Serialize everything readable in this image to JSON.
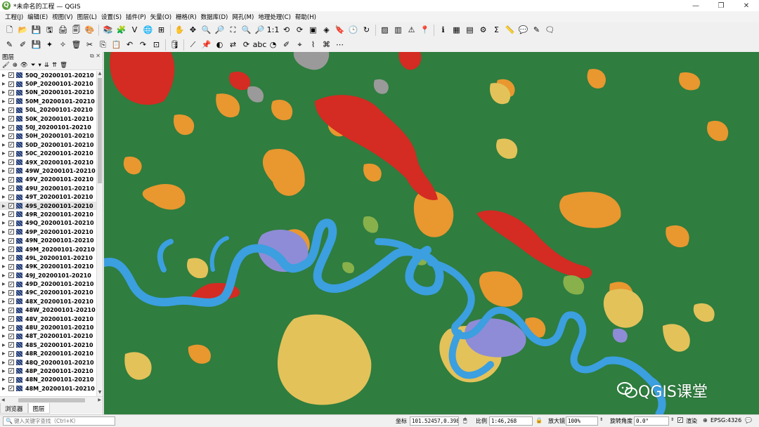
{
  "window": {
    "title": "*未命名的工程 — QGIS",
    "app_icon": "Q",
    "controls": {
      "minimize": "—",
      "maximize": "❐",
      "close": "✕"
    }
  },
  "menu": [
    "工程(J)",
    "编辑(E)",
    "视图(V)",
    "图层(L)",
    "设置(S)",
    "插件(P)",
    "矢量(O)",
    "栅格(R)",
    "数据库(D)",
    "网孔(M)",
    "地理处理(C)",
    "帮助(H)"
  ],
  "toolbar1": [
    {
      "icon": "new-project-icon",
      "glyph": "🗋"
    },
    {
      "icon": "open-project-icon",
      "glyph": "📂"
    },
    {
      "icon": "save-project-icon",
      "glyph": "💾"
    },
    {
      "icon": "save-as-icon",
      "glyph": "🖫"
    },
    {
      "icon": "new-print-layout-icon",
      "glyph": "🖨"
    },
    {
      "icon": "layout-manager-icon",
      "glyph": "🗐"
    },
    {
      "icon": "style-manager-icon",
      "glyph": "🎨"
    },
    {
      "sep": true
    },
    {
      "icon": "data-source-manager-icon",
      "glyph": "📚"
    },
    {
      "icon": "add-raster-icon",
      "glyph": "🧩"
    },
    {
      "icon": "add-vector-icon",
      "glyph": "V"
    },
    {
      "icon": "add-wms-icon",
      "glyph": "🌐"
    },
    {
      "icon": "add-mesh-icon",
      "glyph": "⊞"
    },
    {
      "sep": true
    },
    {
      "icon": "pan-icon",
      "glyph": "✋"
    },
    {
      "icon": "pan-to-selection-icon",
      "glyph": "✥"
    },
    {
      "icon": "zoom-in-icon",
      "glyph": "🔍"
    },
    {
      "icon": "zoom-out-icon",
      "glyph": "🔎"
    },
    {
      "icon": "zoom-full-icon",
      "glyph": "⛶"
    },
    {
      "icon": "zoom-layer-icon",
      "glyph": "🔍"
    },
    {
      "icon": "zoom-selection-icon",
      "glyph": "🔎"
    },
    {
      "icon": "zoom-native-icon",
      "glyph": "1:1"
    },
    {
      "icon": "zoom-last-icon",
      "glyph": "⟲"
    },
    {
      "icon": "zoom-next-icon",
      "glyph": "⟳"
    },
    {
      "icon": "new-map-view-icon",
      "glyph": "▣"
    },
    {
      "icon": "new-3d-view-icon",
      "glyph": "◈"
    },
    {
      "icon": "bookmark-icon",
      "glyph": "🔖"
    },
    {
      "icon": "temporal-controller-icon",
      "glyph": "🕒"
    },
    {
      "icon": "refresh-icon",
      "glyph": "↻"
    },
    {
      "sep": true
    },
    {
      "icon": "select-features-icon",
      "glyph": "▨"
    },
    {
      "icon": "select-value-icon",
      "glyph": "▥"
    },
    {
      "icon": "deselect-icon",
      "glyph": "⚠"
    },
    {
      "icon": "select-location-icon",
      "glyph": "📍"
    },
    {
      "sep": true
    },
    {
      "icon": "identify-icon",
      "glyph": "ℹ"
    },
    {
      "icon": "attribute-table-icon",
      "glyph": "▦"
    },
    {
      "icon": "field-calc-icon",
      "glyph": "▤"
    },
    {
      "icon": "processing-toolbox-icon",
      "glyph": "⚙"
    },
    {
      "icon": "statistical-summary-icon",
      "glyph": "Σ"
    },
    {
      "icon": "measure-icon",
      "glyph": "📏"
    },
    {
      "icon": "map-tips-icon",
      "glyph": "💬"
    },
    {
      "icon": "annotation-icon",
      "glyph": "✎"
    },
    {
      "icon": "text-annotation-icon",
      "glyph": "🗨"
    }
  ],
  "toolbar2": [
    {
      "icon": "edit-pencil-icon",
      "glyph": "✎"
    },
    {
      "icon": "toggle-edit-icon",
      "glyph": "✐"
    },
    {
      "icon": "save-edits-icon",
      "glyph": "💾"
    },
    {
      "icon": "add-feature-icon",
      "glyph": "✦"
    },
    {
      "icon": "vertex-tool-icon",
      "glyph": "✧"
    },
    {
      "icon": "delete-selected-icon",
      "glyph": "🗑"
    },
    {
      "icon": "cut-features-icon",
      "glyph": "✂"
    },
    {
      "icon": "copy-features-icon",
      "glyph": "⎘"
    },
    {
      "icon": "paste-features-icon",
      "glyph": "📋"
    },
    {
      "icon": "undo-icon",
      "glyph": "↶"
    },
    {
      "icon": "redo-icon",
      "glyph": "↷"
    },
    {
      "icon": "digitize-options-icon",
      "glyph": "⊡"
    },
    {
      "sep": true
    },
    {
      "icon": "database-icon",
      "glyph": "🛢"
    },
    {
      "sep": true
    },
    {
      "icon": "label-tool-icon",
      "glyph": "⟋"
    },
    {
      "icon": "label-pin-icon",
      "glyph": "📌"
    },
    {
      "icon": "label-show-icon",
      "glyph": "◐"
    },
    {
      "icon": "label-move-icon",
      "glyph": "⇄"
    },
    {
      "icon": "label-rotate-icon",
      "glyph": "⟳"
    },
    {
      "icon": "label-change-icon",
      "glyph": "abc"
    },
    {
      "icon": "diagram-icon",
      "glyph": "◔"
    },
    {
      "icon": "label-highlight-icon",
      "glyph": "✐"
    },
    {
      "icon": "label-unpin-icon",
      "glyph": "⌖"
    },
    {
      "icon": "label-callout-icon",
      "glyph": "⌇"
    },
    {
      "icon": "label-toggle-icon",
      "glyph": "⌘"
    },
    {
      "icon": "label-more-icon",
      "glyph": "⋯"
    }
  ],
  "layers_panel": {
    "title": "图层",
    "layers": [
      "50Q_20200101-20210",
      "50P_20200101-20210",
      "50N_20200101-20210",
      "50M_20200101-20210",
      "50L_20200101-20210",
      "50K_20200101-20210",
      "50J_20200101-20210",
      "50H_20200101-20210",
      "50D_20200101-20210",
      "50C_20200101-20210",
      "49X_20200101-20210",
      "49W_20200101-20210",
      "49V_20200101-20210",
      "49U_20200101-20210",
      "49T_20200101-20210",
      "49S_20200101-20210",
      "49R_20200101-20210",
      "49Q_20200101-20210",
      "49P_20200101-20210",
      "49N_20200101-20210",
      "49M_20200101-20210",
      "49L_20200101-20210",
      "49K_20200101-20210",
      "49J_20200101-20210",
      "49D_20200101-20210",
      "49C_20200101-20210",
      "48X_20200101-20210",
      "48W_20200101-20210",
      "48V_20200101-20210",
      "48U_20200101-20210",
      "48T_20200101-20210",
      "48S_20200101-20210",
      "48R_20200101-20210",
      "48Q_20200101-20210",
      "48P_20200101-20210",
      "48N_20200101-20210",
      "48M_20200101-20210"
    ],
    "selected_index": 15,
    "tabs": [
      "浏览器",
      "图层"
    ],
    "active_tab": 1
  },
  "map": {
    "colors": {
      "forest": "#2f7d3f",
      "crop": "#e9972f",
      "urban": "#d42b22",
      "water": "#3b9fe0",
      "grass": "#e3c25a",
      "bare": "#9a9a9a",
      "flooded": "#8e8cd6",
      "shrub": "#88b04b"
    },
    "watermark": "QGIS课堂"
  },
  "statusbar": {
    "search_placeholder": "键入关键字查找（Ctrl+K）",
    "coord_label": "坐标",
    "coord_value": "101.52457,0.39898",
    "scale_label": "比例",
    "scale_value": "1:46,268",
    "magnifier_label": "放大镜",
    "magnifier_value": "100%",
    "rotation_label": "旋转角度",
    "rotation_value": "0.0°",
    "render_label": "渲染",
    "crs_value": "EPSG:4326"
  }
}
